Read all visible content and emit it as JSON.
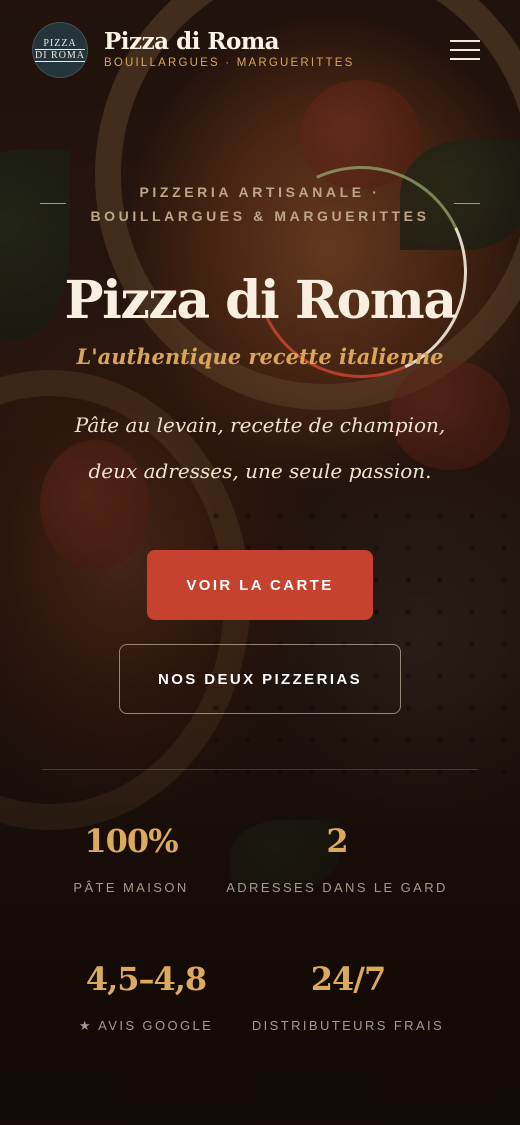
{
  "header": {
    "logo_line1": "PIZZA",
    "logo_line2": "DI ROMA",
    "brand_name": "Pizza di Roma",
    "brand_sub": "BOUILLARGUES · MARGUERITTES",
    "menu_icon": "hamburger-menu-icon"
  },
  "hero": {
    "eyebrow_line1": "PIZZERIA ARTISANALE ·",
    "eyebrow_line2": "BOUILLARGUES & MARGUERITTES",
    "title": "Pizza di Roma",
    "tagline": "L'authentique recette italienne",
    "description": "Pâte au levain, recette de champion, deux adresses, une seule passion.",
    "cta_primary": "VOIR LA CARTE",
    "cta_secondary": "NOS DEUX PIZZERIAS"
  },
  "stats": [
    {
      "value": "100%",
      "label": "PÂTE MAISON"
    },
    {
      "value": "2",
      "label": "ADRESSES DANS LE GARD"
    },
    {
      "value": "4,5–4,8",
      "label": "★ AVIS GOOGLE"
    },
    {
      "value": "24/7",
      "label": "DISTRIBUTEURS FRAIS"
    }
  ],
  "colors": {
    "accent_gold": "#d8a65a",
    "primary_red": "#c6422e",
    "background": "#1a0f0a"
  }
}
